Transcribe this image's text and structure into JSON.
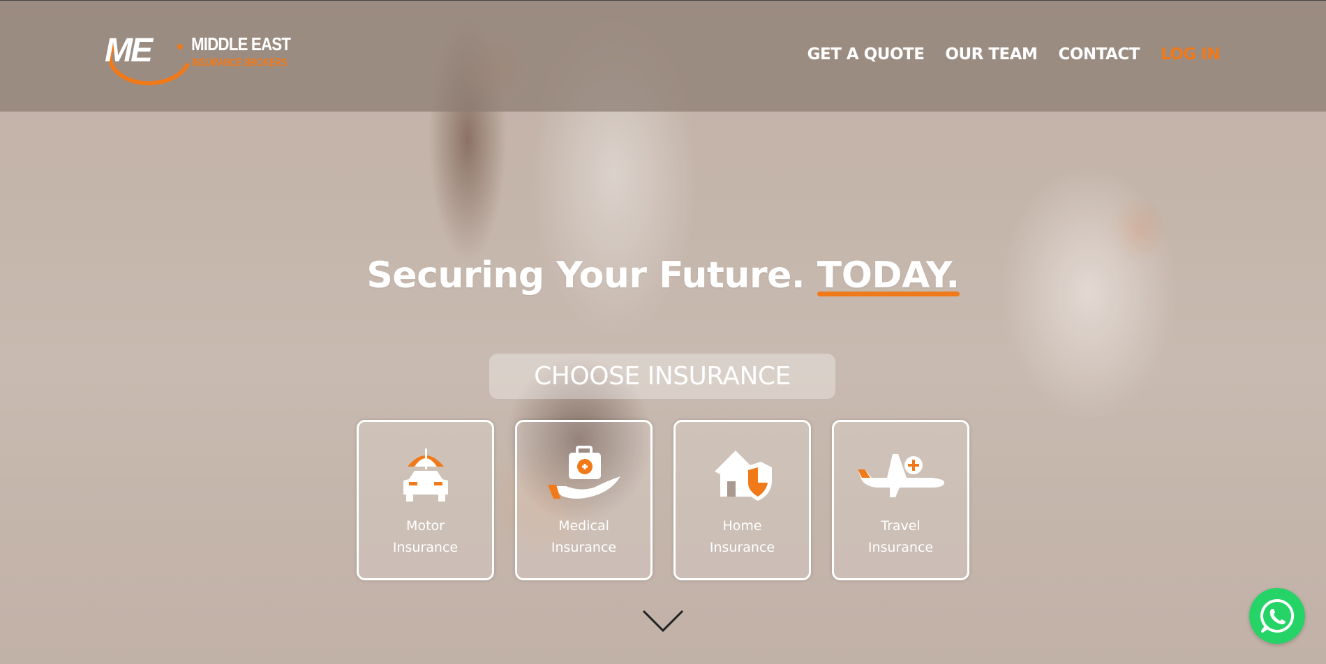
{
  "brand": {
    "logo_mark": "ME",
    "name_line1": "MIDDLE EAST",
    "name_line2": "INSURANCE BROKERS",
    "accent_color": "#f07a1a"
  },
  "nav": {
    "items": [
      {
        "label": "GET A QUOTE"
      },
      {
        "label": "OUR TEAM"
      },
      {
        "label": "CONTACT"
      },
      {
        "label": "LOG IN"
      }
    ]
  },
  "hero": {
    "headline_main": "Securing Your Future. ",
    "headline_emphasis": "TODAY."
  },
  "choose": {
    "title": "CHOOSE INSURANCE"
  },
  "insurance_cards": [
    {
      "line1": "Motor",
      "line2": "Insurance",
      "icon": "car-umbrella-icon"
    },
    {
      "line1": "Medical",
      "line2": "Insurance",
      "icon": "medical-kit-hand-icon"
    },
    {
      "line1": "Home",
      "line2": "Insurance",
      "icon": "house-shield-icon"
    },
    {
      "line1": "Travel",
      "line2": "Insurance",
      "icon": "airplane-plus-icon"
    }
  ],
  "icons": {
    "scroll": "chevron-down-icon",
    "chat": "whatsapp-icon"
  }
}
